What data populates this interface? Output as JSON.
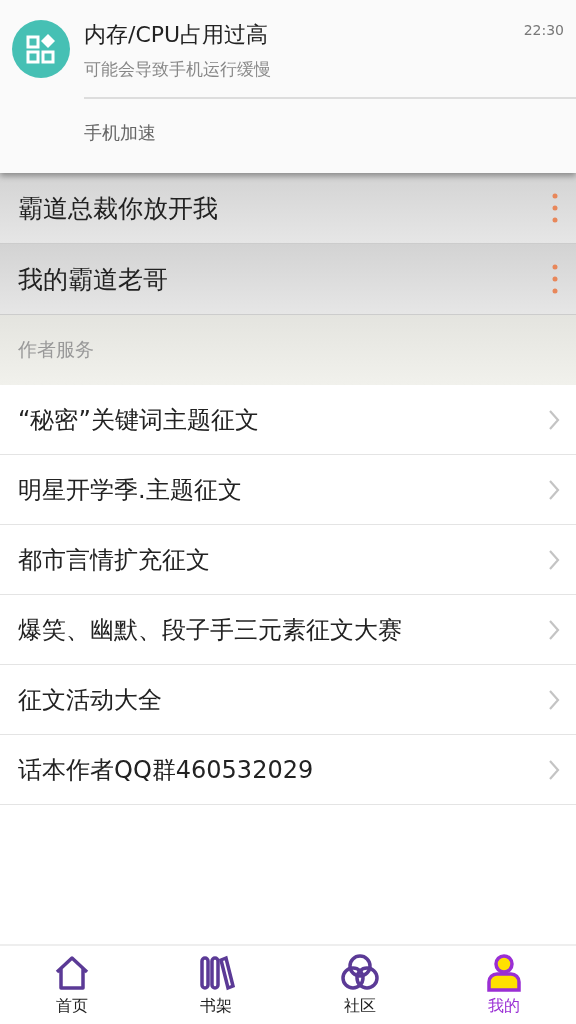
{
  "notification": {
    "title": "内存/CPU占用过高",
    "time": "22:30",
    "message": "可能会导致手机运行缓慢",
    "action": "手机加速"
  },
  "works": [
    {
      "title": "霸道总裁你放开我"
    },
    {
      "title": "我的霸道老哥"
    }
  ],
  "section": {
    "title": "作者服务"
  },
  "services": [
    {
      "label": "“秘密”关键词主题征文"
    },
    {
      "label": "明星开学季.主题征文"
    },
    {
      "label": "都市言情扩充征文"
    },
    {
      "label": "爆笑、幽默、段子手三元素征文大赛"
    },
    {
      "label": "征文活动大全"
    },
    {
      "label": "话本作者QQ群460532029"
    }
  ],
  "tabs": [
    {
      "kind": "home",
      "label": "首页",
      "selected": false
    },
    {
      "kind": "shelf",
      "label": "书架",
      "selected": false
    },
    {
      "kind": "community",
      "label": "社区",
      "selected": false
    },
    {
      "kind": "profile",
      "label": "我的",
      "selected": true
    }
  ]
}
